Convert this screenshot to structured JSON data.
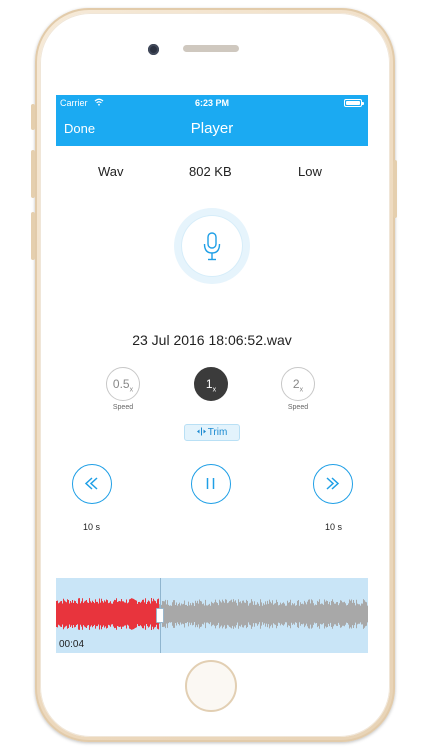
{
  "status": {
    "carrier": "Carrier",
    "time": "6:23 PM"
  },
  "nav": {
    "done_label": "Done",
    "title": "Player"
  },
  "info": {
    "format": "Wav",
    "size": "802 KB",
    "quality": "Low"
  },
  "recording": {
    "filename": "23 Jul 2016 18:06:52.wav"
  },
  "speeds": [
    {
      "value": "0.5",
      "unit": "x",
      "label": "Speed",
      "active": false
    },
    {
      "value": "1",
      "unit": "x",
      "label": "",
      "active": true
    },
    {
      "value": "2",
      "unit": "x",
      "label": "Speed",
      "active": false
    }
  ],
  "trim": {
    "label": "Trim"
  },
  "controls": {
    "rewind_label": "10 s",
    "forward_label": "10 s"
  },
  "waveform": {
    "current_time": "00:04",
    "played_color": "#e8343d",
    "unplayed_color": "#a8a8a8",
    "progress": 0.33
  },
  "colors": {
    "accent": "#1baaf2",
    "icon": "#1f9fe6"
  },
  "icons": {
    "mic": "microphone-icon",
    "rewind": "rewind-icon",
    "pause": "pause-icon",
    "forward": "fast-forward-icon",
    "trim": "trim-icon",
    "wifi": "wifi-icon",
    "battery": "battery-icon"
  }
}
